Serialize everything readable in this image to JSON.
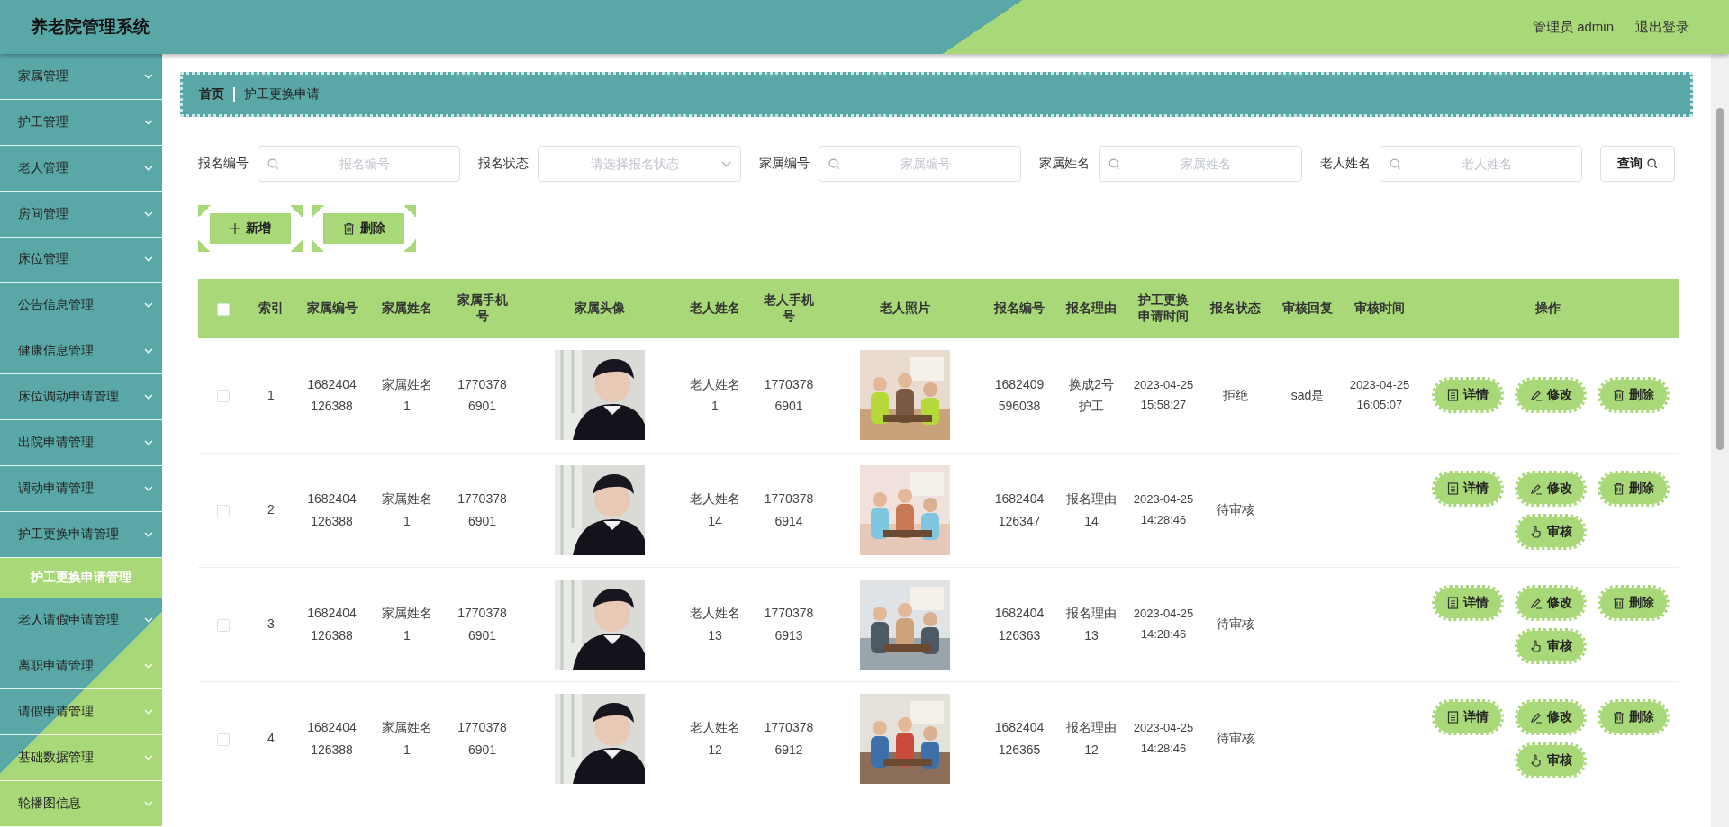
{
  "header": {
    "title": "养老院管理系统",
    "user": "管理员 admin",
    "logout": "退出登录"
  },
  "sidebar": {
    "items": [
      {
        "label": "家属管理"
      },
      {
        "label": "护工管理"
      },
      {
        "label": "老人管理"
      },
      {
        "label": "房间管理"
      },
      {
        "label": "床位管理"
      },
      {
        "label": "公告信息管理"
      },
      {
        "label": "健康信息管理"
      },
      {
        "label": "床位调动申请管理"
      },
      {
        "label": "出院申请管理"
      },
      {
        "label": "调动申请管理"
      },
      {
        "label": "护工更换申请管理",
        "children": [
          {
            "label": "护工更换申请管理",
            "selected": true
          }
        ]
      },
      {
        "label": "老人请假申请管理"
      },
      {
        "label": "离职申请管理"
      },
      {
        "label": "请假申请管理"
      },
      {
        "label": "基础数据管理"
      },
      {
        "label": "轮播图信息"
      }
    ]
  },
  "breadcrumb": [
    "首页",
    "护工更换申请"
  ],
  "search": {
    "fields": [
      {
        "kind": "input",
        "label": "报名编号",
        "placeholder": "报名编号"
      },
      {
        "kind": "select",
        "label": "报名状态",
        "placeholder": "请选择报名状态"
      },
      {
        "kind": "input",
        "label": "家属编号",
        "placeholder": "家属编号"
      },
      {
        "kind": "input",
        "label": "家属姓名",
        "placeholder": "家属姓名"
      },
      {
        "kind": "input",
        "label": "老人姓名",
        "placeholder": "老人姓名"
      }
    ],
    "button": "查询"
  },
  "toolbar": [
    {
      "kind": "add",
      "label": "新增"
    },
    {
      "kind": "delete",
      "label": "删除"
    }
  ],
  "table": {
    "select_all": {
      "checked": false
    },
    "columns": [
      "索引",
      "家属编号",
      "家属姓名",
      "家属手机号",
      "家属头像",
      "老人姓名",
      "老人手机号",
      "老人照片",
      "报名编号",
      "报名理由",
      "护工更换申请时间",
      "报名状态",
      "审核回复",
      "审核时间",
      "操作"
    ],
    "rows": [
      {
        "checked": false,
        "index": "1",
        "family_no": "1682404126388",
        "family_name": "家属姓名1",
        "family_phone": "17703786901",
        "elder_name": "老人姓名1",
        "elder_phone": "17703786901",
        "apply_no": "1682409596038",
        "reason": "换成2号护工",
        "apply_time": "2023-04-25 15:58:27",
        "status": "拒绝",
        "reply": "sad是",
        "review_time": "2023-04-25 16:05:07",
        "actions": [
          {
            "kind": "detail",
            "label": "详情"
          },
          {
            "kind": "edit",
            "label": "修改"
          },
          {
            "kind": "delete",
            "label": "删除"
          }
        ]
      },
      {
        "checked": false,
        "index": "2",
        "family_no": "1682404126388",
        "family_name": "家属姓名1",
        "family_phone": "17703786901",
        "elder_name": "老人姓名14",
        "elder_phone": "17703786914",
        "apply_no": "1682404126347",
        "reason": "报名理由14",
        "apply_time": "2023-04-25 14:28:46",
        "status": "待审核",
        "actions": [
          {
            "kind": "detail",
            "label": "详情"
          },
          {
            "kind": "edit",
            "label": "修改"
          },
          {
            "kind": "delete",
            "label": "删除"
          },
          {
            "kind": "review",
            "label": "审核"
          }
        ]
      },
      {
        "checked": false,
        "index": "3",
        "family_no": "1682404126388",
        "family_name": "家属姓名1",
        "family_phone": "17703786901",
        "elder_name": "老人姓名13",
        "elder_phone": "17703786913",
        "apply_no": "1682404126363",
        "reason": "报名理由13",
        "apply_time": "2023-04-25 14:28:46",
        "status": "待审核",
        "actions": [
          {
            "kind": "detail",
            "label": "详情"
          },
          {
            "kind": "edit",
            "label": "修改"
          },
          {
            "kind": "delete",
            "label": "删除"
          },
          {
            "kind": "review",
            "label": "审核"
          }
        ]
      },
      {
        "checked": false,
        "index": "4",
        "family_no": "1682404126388",
        "family_name": "家属姓名1",
        "family_phone": "17703786901",
        "elder_name": "老人姓名12",
        "elder_phone": "17703786912",
        "apply_no": "1682404126365",
        "reason": "报名理由12",
        "apply_time": "2023-04-25 14:28:46",
        "status": "待审核",
        "actions": [
          {
            "kind": "detail",
            "label": "详情"
          },
          {
            "kind": "edit",
            "label": "修改"
          },
          {
            "kind": "delete",
            "label": "删除"
          },
          {
            "kind": "review",
            "label": "审核"
          }
        ]
      }
    ]
  }
}
